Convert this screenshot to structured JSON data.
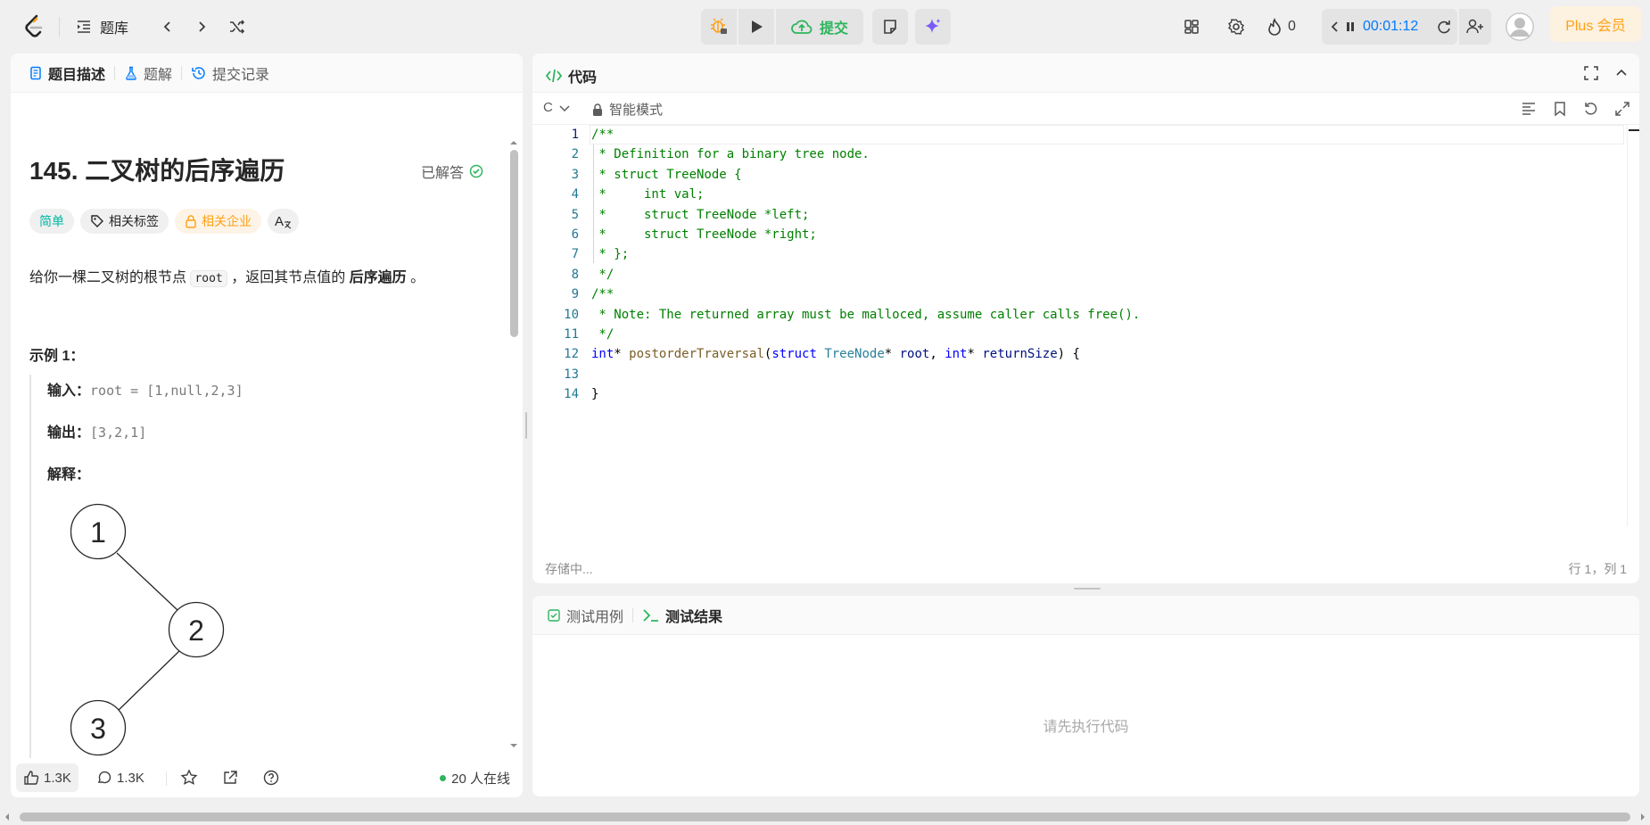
{
  "header": {
    "problem_bank": "题库",
    "submit": "提交",
    "streak": "0",
    "timer": "00:01:12",
    "plus": "Plus 会员"
  },
  "left": {
    "tabs": [
      {
        "label": "题目描述"
      },
      {
        "label": "题解"
      },
      {
        "label": "提交记录"
      }
    ],
    "title": "145. 二叉树的后序遍历",
    "solved": "已解答",
    "tags": {
      "difficulty": "简单",
      "related_tags": "相关标签",
      "companies": "相关企业",
      "translate": "A"
    },
    "description": {
      "pre": "给你一棵二叉树的根节点 ",
      "code": "root",
      "mid": " ，返回其节点值的 ",
      "bold": "后序遍历",
      "post": " 。"
    },
    "example": {
      "heading": "示例 1：",
      "input_label": "输入：",
      "input_value": "root = [1,null,2,3]",
      "output_label": "输出：",
      "output_value": "[3,2,1]",
      "explain_label": "解释："
    },
    "tree_nodes": [
      "1",
      "2",
      "3"
    ],
    "footer": {
      "likes": "1.3K",
      "comments": "1.3K",
      "online": "20 人在线"
    }
  },
  "editor": {
    "title": "代码",
    "language": "C",
    "mode": "智能模式",
    "saving": "存储中...",
    "cursor": "行 1，列 1",
    "code_lines": [
      "/**",
      " * Definition for a binary tree node.",
      " * struct TreeNode {",
      " *     int val;",
      " *     struct TreeNode *left;",
      " *     struct TreeNode *right;",
      " * };",
      " */",
      "/**",
      " * Note: The returned array must be malloced, assume caller calls free().",
      " */",
      "int* postorderTraversal(struct TreeNode* root, int* returnSize) {",
      "",
      "}"
    ]
  },
  "results": {
    "tabs": [
      {
        "label": "测试用例"
      },
      {
        "label": "测试结果"
      }
    ],
    "empty": "请先执行代码"
  }
}
